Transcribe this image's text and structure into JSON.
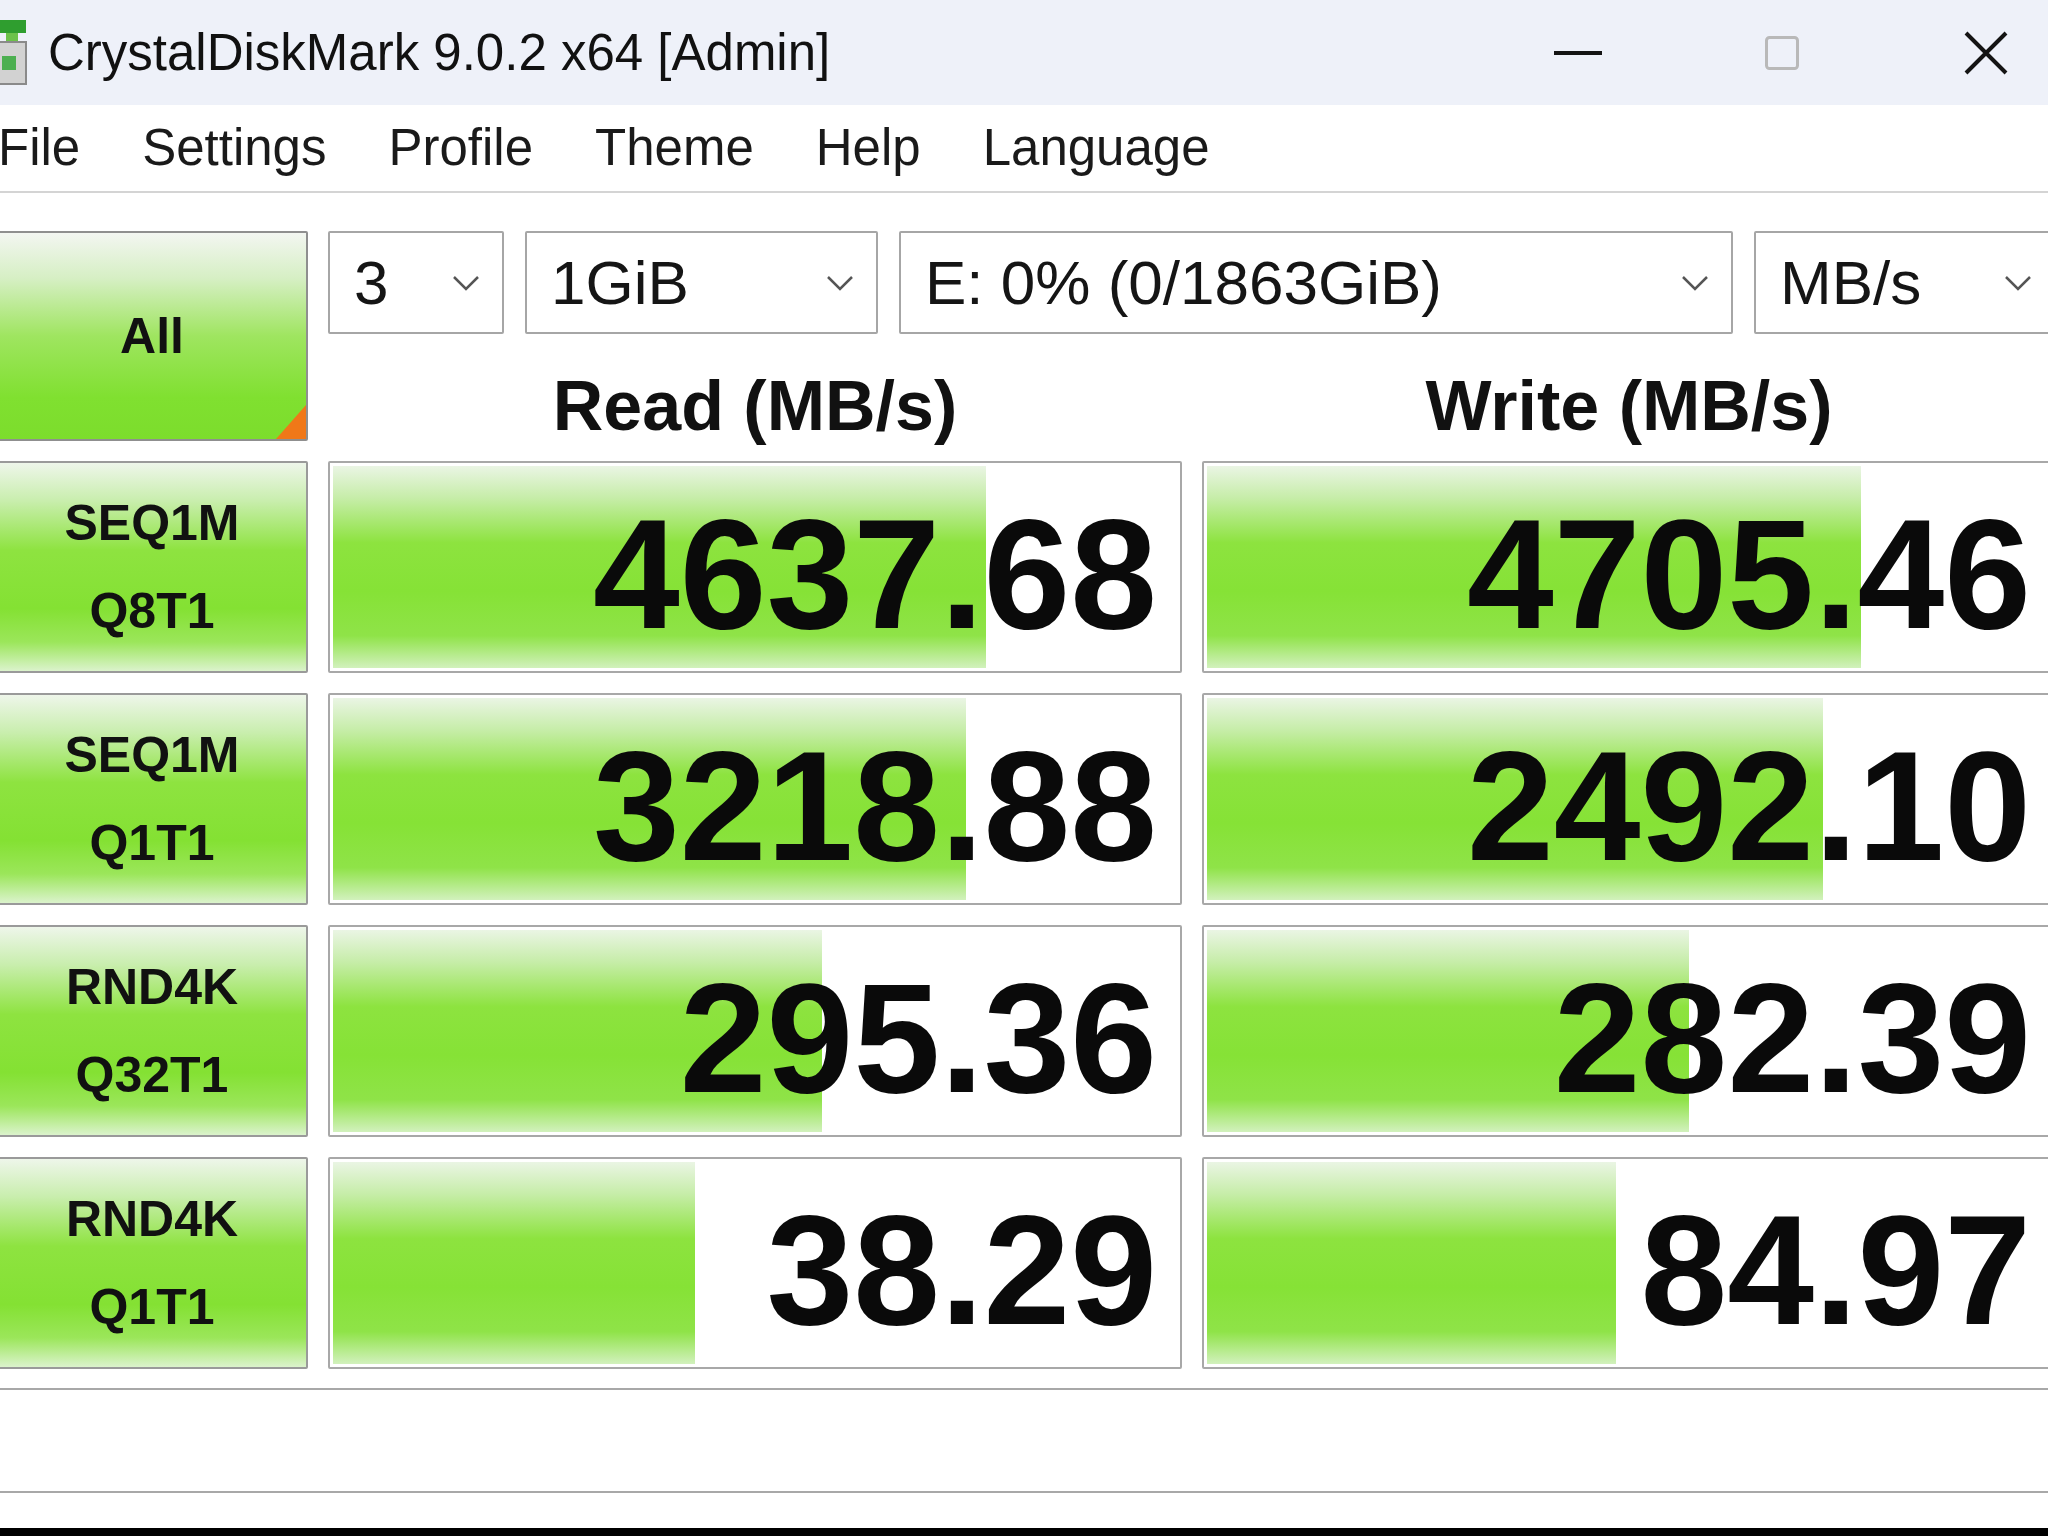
{
  "window": {
    "title": "CrystalDiskMark 9.0.2 x64 [Admin]",
    "caption_buttons": [
      {
        "kind": "minimize",
        "disabled": false
      },
      {
        "kind": "maximize",
        "disabled": true
      },
      {
        "kind": "close",
        "disabled": false
      }
    ]
  },
  "menu": [
    "File",
    "Settings",
    "Profile",
    "Theme",
    "Help",
    "Language"
  ],
  "toolbar": {
    "all_button": "All",
    "dropdowns": [
      {
        "value": "3"
      },
      {
        "value": "1GiB"
      },
      {
        "value": "E: 0% (0/1863GiB)"
      },
      {
        "value": "MB/s"
      }
    ]
  },
  "headers": [
    "Read (MB/s)",
    "Write (MB/s)"
  ],
  "rows": [
    {
      "test": "SEQ1M",
      "queue": "Q8T1",
      "read": {
        "value": "4637.68",
        "level": 0.774
      },
      "write": {
        "value": "4705.46",
        "level": 0.775
      }
    },
    {
      "test": "SEQ1M",
      "queue": "Q1T1",
      "read": {
        "value": "3218.88",
        "level": 0.75
      },
      "write": {
        "value": "2492.10",
        "level": 0.73
      }
    },
    {
      "test": "RND4K",
      "queue": "Q32T1",
      "read": {
        "value": "295.36",
        "level": 0.579
      },
      "write": {
        "value": "282.39",
        "level": 0.571
      }
    },
    {
      "test": "RND4K",
      "queue": "Q1T1",
      "read": {
        "value": "38.29",
        "level": 0.429
      },
      "write": {
        "value": "84.97",
        "level": 0.485
      }
    }
  ]
}
